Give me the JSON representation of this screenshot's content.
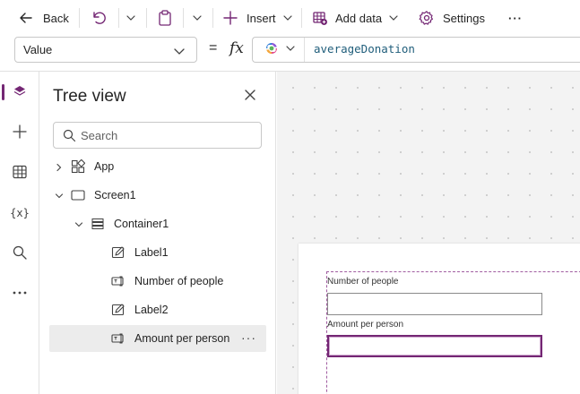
{
  "toolbar": {
    "back_label": "Back",
    "insert_label": "Insert",
    "add_data_label": "Add data",
    "settings_label": "Settings",
    "more_label": "···"
  },
  "formula_bar": {
    "property": "Value",
    "equals": "=",
    "fx": "fx",
    "formula": "averageDonation"
  },
  "left_rail": {
    "variables_label": "{x}"
  },
  "tree_view": {
    "title": "Tree view",
    "search_placeholder": "Search",
    "items": [
      {
        "label": "App"
      },
      {
        "label": "Screen1"
      },
      {
        "label": "Container1"
      },
      {
        "label": "Label1"
      },
      {
        "label": "Number of people"
      },
      {
        "label": "Label2"
      },
      {
        "label": "Amount per person"
      }
    ],
    "more_label": "···"
  },
  "canvas": {
    "label1_text": "Number of people",
    "label2_text": "Amount per person"
  },
  "colors": {
    "accent": "#742774",
    "selected_row": "#ececec",
    "canvas_bg": "#f3f3f3"
  },
  "icons": [
    "back-arrow-icon",
    "undo-icon",
    "paste-icon",
    "plus-icon",
    "database-icon",
    "gear-icon",
    "layers-icon",
    "table-icon",
    "search-icon",
    "close-icon",
    "copilot-icon",
    "chevron-down-icon",
    "chevron-right-icon",
    "app-icon",
    "screen-icon",
    "container-icon",
    "label-icon",
    "text-input-icon"
  ]
}
